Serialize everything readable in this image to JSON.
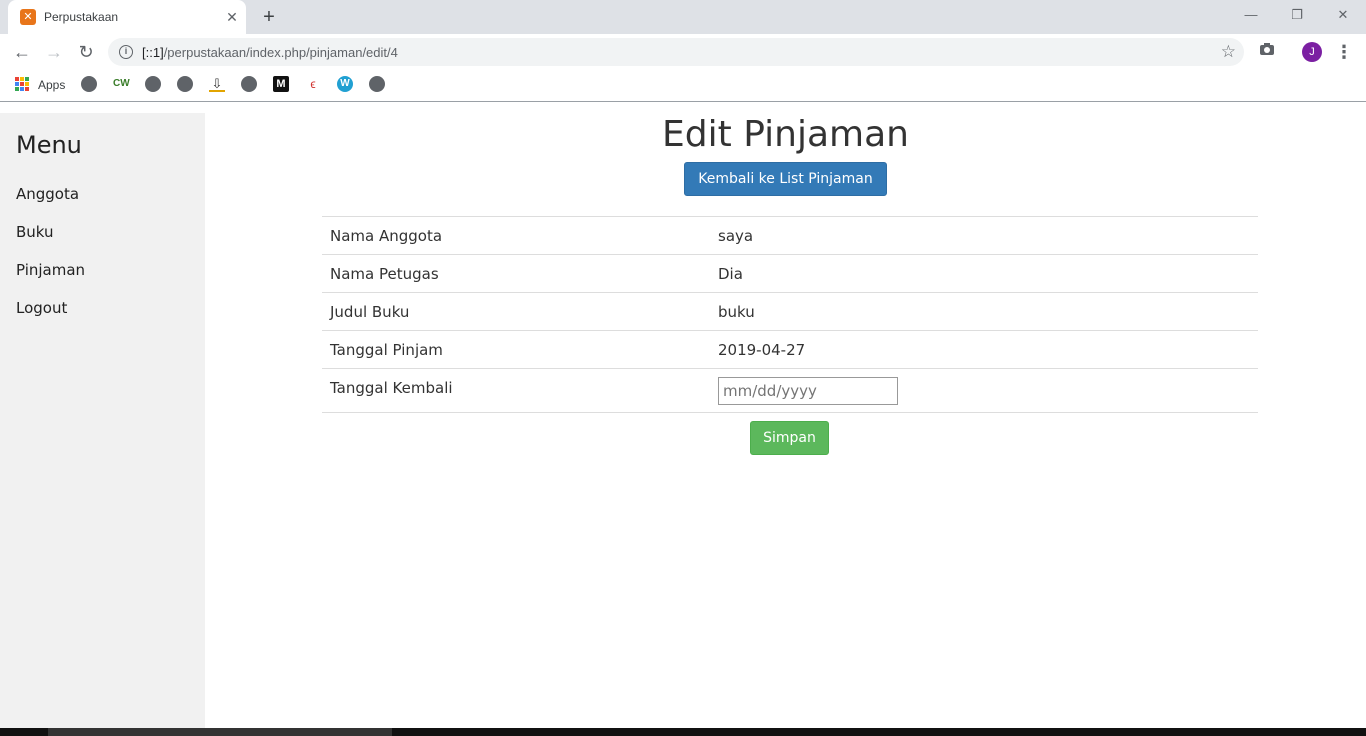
{
  "browser": {
    "tab_title": "Perpustakaan",
    "tab_favicon": "xampp-icon",
    "url_host": "[::1]",
    "url_path": "/perpustakaan/index.php/pinjaman/edit/4",
    "profile_initial": "J",
    "bookmarks_apps_label": "Apps",
    "bookmark_cw_label": "CW",
    "bookmark_m_label": "M",
    "bookmark_wp_label": "W"
  },
  "sidebar": {
    "title": "Menu",
    "items": [
      {
        "label": "Anggota"
      },
      {
        "label": "Buku"
      },
      {
        "label": "Pinjaman"
      },
      {
        "label": "Logout"
      }
    ]
  },
  "main": {
    "title": "Edit Pinjaman",
    "back_button": "Kembali ke List Pinjaman",
    "rows": [
      {
        "label": "Nama Anggota",
        "value": "saya"
      },
      {
        "label": "Nama Petugas",
        "value": "Dia"
      },
      {
        "label": "Judul Buku",
        "value": "buku"
      },
      {
        "label": "Tanggal Pinjam",
        "value": "2019-04-27"
      }
    ],
    "return_date": {
      "label": "Tanggal Kembali",
      "placeholder": "mm/dd/yyyy"
    },
    "save_button": "Simpan"
  },
  "colors": {
    "primary": "#337ab7",
    "success": "#5cb85c",
    "sidebar_bg": "#f1f1f1"
  }
}
